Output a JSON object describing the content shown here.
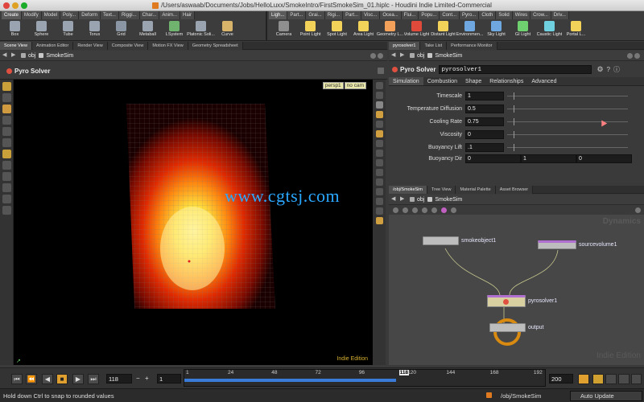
{
  "window": {
    "title": "/Users/aswaab/Documents/Jobs/HelloLuxx/SmokeIntro/FirstSmokeSim_01.hiplc - Houdini Indie Limited-Commercial"
  },
  "shelf_left": {
    "tabs": [
      "Create",
      "Modify",
      "Model",
      "Poly...",
      "Deform",
      "Text...",
      "Riggi...",
      "Char...",
      "Anim...",
      "Hair"
    ],
    "tools": [
      {
        "label": "Box",
        "color": "#9aa4b0"
      },
      {
        "label": "Sphere",
        "color": "#9aa4b0"
      },
      {
        "label": "Tube",
        "color": "#9aa4b0"
      },
      {
        "label": "Torus",
        "color": "#9aa4b0"
      },
      {
        "label": "Grid",
        "color": "#8a96a4"
      },
      {
        "label": "Metaball",
        "color": "#9aa4b0"
      },
      {
        "label": "LSystem",
        "color": "#6fb36f"
      },
      {
        "label": "Platonic Soli...",
        "color": "#9aa4b0"
      },
      {
        "label": "Curve",
        "color": "#d8b36a"
      }
    ]
  },
  "shelf_right": {
    "tabs": [
      "Ligh...",
      "Part...",
      "Grai...",
      "Rigi...",
      "Part...",
      "Visc...",
      "Ocea...",
      "Flui...",
      "Popu...",
      "Cont...",
      "Pyro...",
      "Cloth",
      "Solid",
      "Wires",
      "Crow...",
      "Driv..."
    ],
    "tools": [
      {
        "label": "Camera",
        "color": "#8f8f8f"
      },
      {
        "label": "Point Light",
        "color": "#f3d25a"
      },
      {
        "label": "Spot Light",
        "color": "#f3d25a"
      },
      {
        "label": "Area Light",
        "color": "#f3d25a"
      },
      {
        "label": "Geometry L...",
        "color": "#f3a05a"
      },
      {
        "label": "Volume Light",
        "color": "#e04a3a"
      },
      {
        "label": "Distant Light",
        "color": "#f3d25a"
      },
      {
        "label": "Environmen...",
        "color": "#6fa8e0"
      },
      {
        "label": "Sky Light",
        "color": "#6fa8e0"
      },
      {
        "label": "GI Light",
        "color": "#6fd06f"
      },
      {
        "label": "Caustic Light",
        "color": "#6fd0e0"
      },
      {
        "label": "Portal L...",
        "color": "#f3d25a"
      }
    ]
  },
  "left_pane": {
    "tabs": [
      "Scene View",
      "Animation Editor",
      "Render View",
      "Composite View",
      "Motion FX View",
      "Geometry Spreadsheet"
    ],
    "path": {
      "context": "obj",
      "node": "SmokeSim"
    },
    "viewport_title": "Pyro Solver",
    "cam_buttons": [
      "persp1",
      "no cam"
    ],
    "watermark": "www.cgtsj.com",
    "edition": "Indie Edition"
  },
  "param_pane": {
    "tabs": [
      "pyrosolver1",
      "Take List",
      "Performance Monitor"
    ],
    "path": {
      "context": "obj",
      "node": "SmokeSim"
    },
    "node_type": "Pyro Solver",
    "node_name": "pyrosolver1",
    "subtabs": [
      "Simulation",
      "Combustion",
      "Shape",
      "Relationships",
      "Advanced"
    ],
    "params": [
      {
        "label": "Timescale",
        "value": "1"
      },
      {
        "label": "Temperature Diffusion",
        "value": "0.5"
      },
      {
        "label": "Cooling Rate",
        "value": "0.75"
      },
      {
        "label": "Viscosity",
        "value": "0"
      },
      {
        "label": "Buoyancy Lift",
        "value": ".1"
      }
    ],
    "buoyancy_dir": {
      "label": "Buoyancy Dir",
      "values": [
        "0",
        "1",
        "0"
      ]
    }
  },
  "network_pane": {
    "tabs": [
      "/obj/SmokeSim",
      "Tree View",
      "Material Palette",
      "Asset Browser"
    ],
    "path": {
      "context": "obj",
      "node": "SmokeSim"
    },
    "context_label": "Dynamics",
    "nodes": [
      "smokeobject1",
      "sourcevolume1",
      "pyrosolver1",
      "output"
    ],
    "edition": "Indie Edition"
  },
  "timeline": {
    "current_frame": "118",
    "start_frame": "1",
    "end_frame": "200",
    "ticks": [
      "1",
      "24",
      "48",
      "72",
      "96",
      "118",
      "120",
      "144",
      "168",
      "192"
    ],
    "played_fraction": 0.585
  },
  "status": {
    "message": "Hold down Ctrl to snap to rounded values",
    "path": "/obj/SmokeSim",
    "update_mode": "Auto Update"
  }
}
